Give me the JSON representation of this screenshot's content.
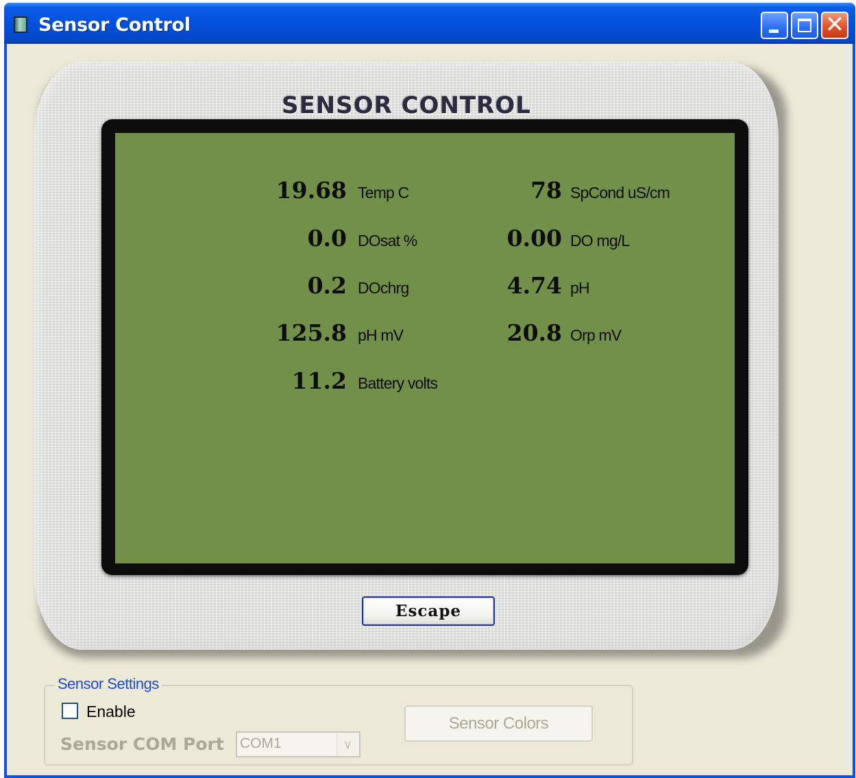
{
  "window": {
    "title": "Sensor Control",
    "controls": {
      "minimize": "minimize",
      "maximize": "maximize",
      "close": "✕"
    }
  },
  "device": {
    "title": "SENSOR CONTROL",
    "readings_left": [
      {
        "value": "19.68",
        "label": "Temp C"
      },
      {
        "value": "0.0",
        "label": "DOsat %"
      },
      {
        "value": "0.2",
        "label": "DOchrg"
      },
      {
        "value": "125.8",
        "label": "pH mV"
      },
      {
        "value": "11.2",
        "label": "Battery volts"
      }
    ],
    "readings_right": [
      {
        "value": "78",
        "label": "SpCond uS/cm"
      },
      {
        "value": "0.00",
        "label": "DO mg/L"
      },
      {
        "value": "4.74",
        "label": "pH"
      },
      {
        "value": "20.8",
        "label": "Orp mV"
      }
    ],
    "escape_label": "Escape"
  },
  "settings": {
    "legend": "Sensor Settings",
    "enable_label": "Enable",
    "enable_checked": false,
    "com_port_label": "Sensor COM Port",
    "com_port_value": "COM1",
    "colors_button": "Sensor Colors"
  },
  "colors": {
    "lcd": "#73904a",
    "titlebar": "#0550dc",
    "legend": "#1c4cd0",
    "disabled_text": "#aca899"
  }
}
